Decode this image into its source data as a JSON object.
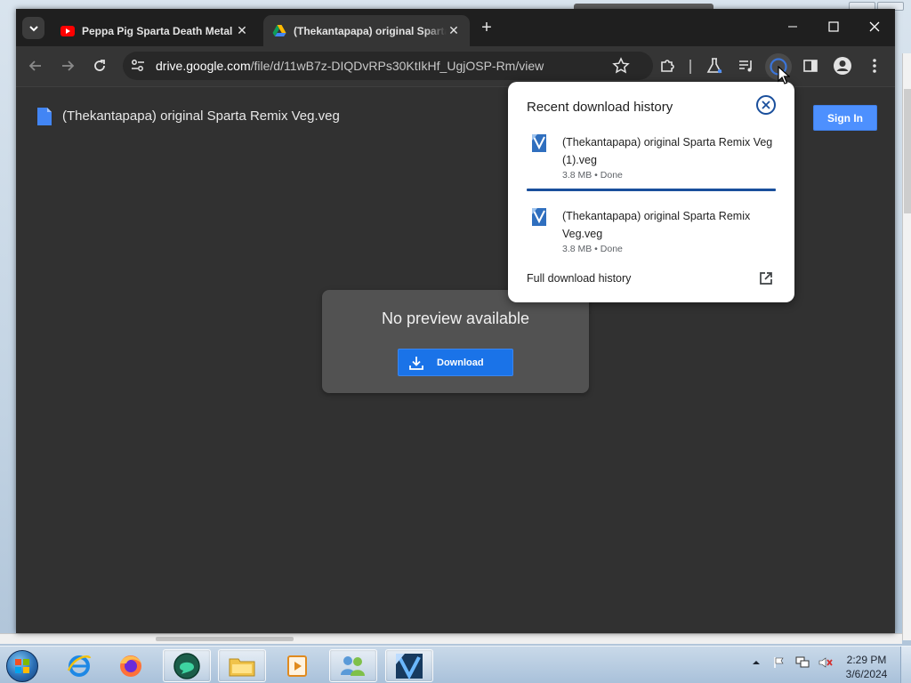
{
  "browser": {
    "tabs": [
      {
        "title": "Peppa Pig Sparta Death Metal",
        "favicon": "youtube-icon",
        "active": false
      },
      {
        "title": "(Thekantapapa) original Sparta Remix Veg.veg",
        "favicon": "google-drive-icon",
        "active": true
      }
    ],
    "address_bar": {
      "host": "drive.google.com",
      "path": "/file/d/11wB7z-DIQDvRPs30KtIkHf_UgjOSP-Rm/view"
    }
  },
  "drive_page": {
    "file_title": "(Thekantapapa) original Sparta Remix Veg.veg",
    "signin_label": "Sign In",
    "no_preview_text": "No preview available",
    "download_label": "Download"
  },
  "download_bubble": {
    "heading": "Recent download history",
    "items": [
      {
        "name": "(Thekantapapa) original Sparta Remix Veg (1).veg",
        "meta": "3.8 MB • Done"
      },
      {
        "name": "(Thekantapapa) original Sparta Remix Veg.veg",
        "meta": "3.8 MB • Done"
      }
    ],
    "full_history_label": "Full download history"
  },
  "taskbar": {
    "apps": [
      "internet-explorer-icon",
      "firefox-icon",
      "chat-app-icon",
      "file-explorer-icon",
      "media-player-icon",
      "people-app-icon",
      "vegas-pro-icon"
    ],
    "clock_time": "2:29 PM",
    "clock_date": "3/6/2024"
  },
  "colors": {
    "accent_blue": "#1a73e8",
    "drive_signin_blue": "#4d90fe",
    "page_bg": "#313131",
    "tab_bg": "#1f1f1f"
  }
}
